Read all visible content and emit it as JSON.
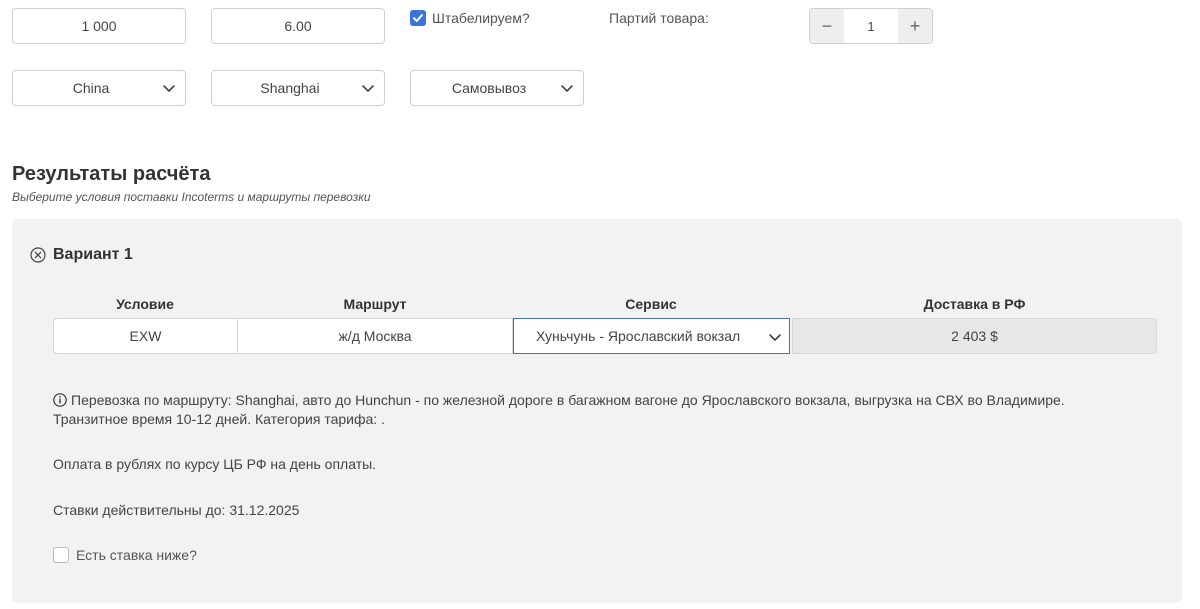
{
  "inputs": {
    "quantity": "1 000",
    "weight": "6.00",
    "stackable_label": "Штабелируем?",
    "batches_label": "Партий товара:",
    "batches_value": "1",
    "minus": "−",
    "plus": "+"
  },
  "selects": {
    "country": "China",
    "city": "Shanghai",
    "delivery_type": "Самовывоз"
  },
  "results": {
    "title": "Результаты расчёта",
    "subtitle": "Выберите условия поставки Incoterms и маршруты перевозки"
  },
  "variant": {
    "name": "Вариант 1",
    "headers": {
      "condition": "Условие",
      "route": "Маршрут",
      "service": "Сервис",
      "delivery": "Доставка в РФ"
    },
    "row": {
      "condition": "EXW",
      "route": "ж/д Москва",
      "service": "Хуньчунь - Ярославский вокзал",
      "delivery": "2 403 $"
    },
    "info_line": "Перевозка по маршруту: Shanghai, авто до Hunchun - по железной дороге в багажном вагоне до Ярославского вокзала, выгрузка на СВХ во Владимире. Транзитное время 10-12 дней. Категория тарифа: .",
    "payment_note": "Оплата в рублях по курсу ЦБ РФ на день оплаты.",
    "valid_note": "Ставки действительны до: 31.12.2025",
    "lower_rate_label": "Есть ставка ниже?"
  },
  "colors": {
    "accent": "#3b74d9",
    "card_bg": "#f2f2f2"
  }
}
